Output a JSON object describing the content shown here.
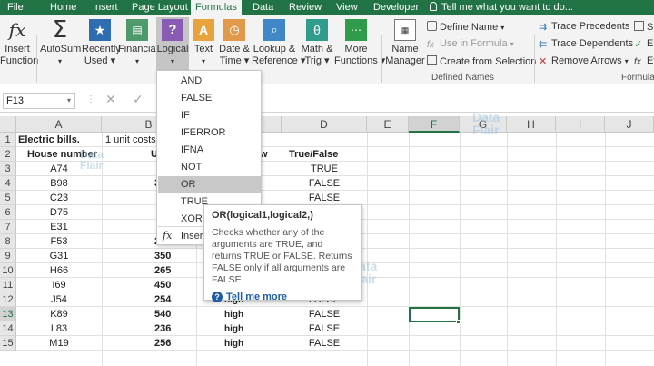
{
  "tabs": [
    "File",
    "Home",
    "Insert",
    "Page Layout",
    "Formulas",
    "Data",
    "Review",
    "View",
    "Developer"
  ],
  "tell_me": "Tell me what you want to do...",
  "ribbon": {
    "insert_function": [
      "Insert",
      "Function"
    ],
    "autosum": [
      "AutoSum"
    ],
    "recently_used": [
      "Recently",
      "Used"
    ],
    "financial": [
      "Financial"
    ],
    "logical": [
      "Logical"
    ],
    "text": [
      "Text"
    ],
    "date_time": [
      "Date &",
      "Time"
    ],
    "lookup": [
      "Lookup &",
      "Reference"
    ],
    "math": [
      "Math &",
      "Trig"
    ],
    "more": [
      "More",
      "Functions"
    ],
    "name_manager": [
      "Name",
      "Manager"
    ],
    "define_name": "Define Name",
    "use_in_formula": "Use in Formula",
    "create_from_selection": "Create from Selection",
    "defined_names_group": "Defined Names",
    "trace_precedents": "Trace Precedents",
    "trace_dependents": "Trace Dependents",
    "remove_arrows": "Remove Arrows",
    "formula_auditing_group": "Formula A",
    "show_partial": "Sh",
    "error_partial": "Er",
    "eval_partial": "Ev",
    "colors": {
      "excel_green": "#217346",
      "ribbon_bg": "#f3f3f3"
    }
  },
  "formula_bar": {
    "name_box": "F13",
    "fx": "fx"
  },
  "columns": [
    "A",
    "B",
    "C",
    "D",
    "E",
    "F",
    "G",
    "H",
    "I",
    "J"
  ],
  "selected_column": "F",
  "selected_row": "13",
  "rows": [
    "1",
    "2",
    "3",
    "4",
    "5",
    "6",
    "7",
    "8",
    "9",
    "10",
    "11",
    "12",
    "13",
    "14",
    "15"
  ],
  "sheet": {
    "a1": "Electric bills.",
    "b1": "1 unit costs",
    "a2": "House number",
    "b2": "U",
    "c2": "w",
    "d2": "True/False",
    "house": [
      "A74",
      "B98",
      "C23",
      "D75",
      "E31",
      "F53",
      "G31",
      "H66",
      "I69",
      "J54",
      "K89",
      "L83",
      "M19"
    ],
    "units_visible": {
      "4": "3",
      "8": "2",
      "9": "350",
      "10": "265",
      "11": "450",
      "12": "254",
      "13": "540",
      "14": "236",
      "15": "256"
    },
    "usage_visible": {
      "11": "high",
      "12": "high",
      "13": "high",
      "14": "high",
      "15": "high"
    },
    "tf": [
      "TRUE",
      "FALSE",
      "FALSE",
      "FALSE",
      "FALSE",
      "FALSE",
      "FALSE",
      "FALSE",
      "FALSE",
      "FALSE",
      "FALSE",
      "FALSE",
      "FALSE"
    ]
  },
  "dropdown": {
    "items": [
      "AND",
      "FALSE",
      "IF",
      "IFERROR",
      "IFNA",
      "NOT",
      "OR",
      "TRUE",
      "XOR"
    ],
    "highlighted": "OR",
    "insert_function": "Insert"
  },
  "tooltip": {
    "signature": "OR(logical1,logical2,)",
    "description": "Checks whether any of the arguments are TRUE, and returns TRUE or FALSE. Returns FALSE only if all arguments are FALSE.",
    "link": "Tell me more"
  },
  "watermark": [
    "Data",
    "Flair"
  ]
}
